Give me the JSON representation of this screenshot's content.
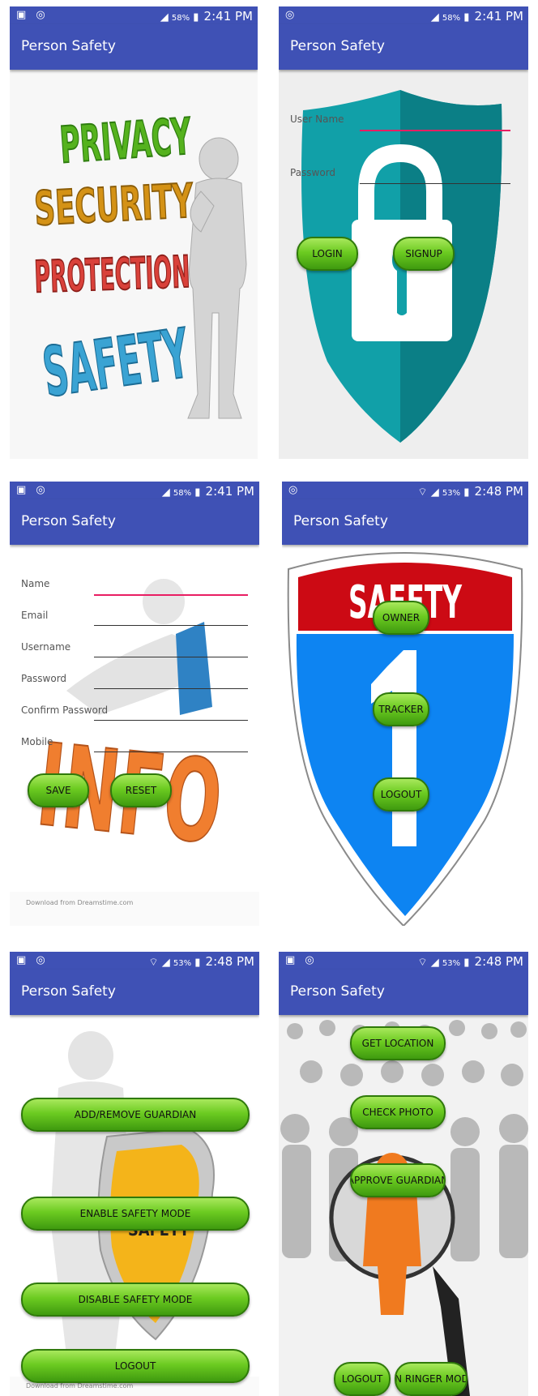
{
  "app": {
    "title": "Person Safety"
  },
  "status": {
    "battery_a": "58%",
    "time_a": "2:41 PM",
    "battery_b": "53%",
    "time_b": "2:48 PM"
  },
  "screen1": {
    "image_words": [
      "PRIVACY",
      "SECURITY",
      "PROTECTION",
      "SAFETY"
    ]
  },
  "screen2": {
    "username_label": "User Name",
    "password_label": "Password",
    "login": "LOGIN",
    "signup": "SIGNUP"
  },
  "screen3": {
    "fields": [
      "Name",
      "Email",
      "Username",
      "Password",
      "Confirm Password",
      "Mobile"
    ],
    "save": "SAVE",
    "reset": "RESET",
    "image_word": "INFO",
    "watermark": "Download from Dreamstime.com"
  },
  "screen4": {
    "sign_word": "SAFETY",
    "owner": "OWNER",
    "tracker": "TRACKER",
    "logout": "LOGOUT"
  },
  "screen5": {
    "add_remove": "ADD/REMOVE GUARDIAN",
    "enable": "ENABLE SAFETY MODE",
    "disable": "DISABLE SAFETY MODE",
    "logout": "LOGOUT",
    "shield_word": "SAFETY",
    "watermark": "Download from Dreamstime.com"
  },
  "screen6": {
    "get_location": "GET LOCATION",
    "check_photo": "CHECK PHOTO",
    "approve": "APPROVE GUARDIAN",
    "logout": "LOGOUT",
    "ringer": "ON RINGER MODE"
  },
  "colors": {
    "primary": "#3f51b5",
    "button_green": "#6ccb21",
    "focus": "#e91e63"
  }
}
